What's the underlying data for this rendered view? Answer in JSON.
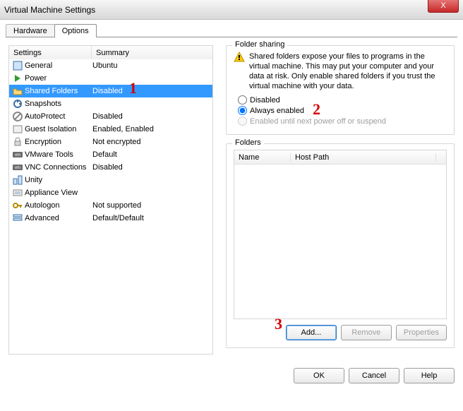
{
  "window": {
    "title": "Virtual Machine Settings",
    "close": "X"
  },
  "tabs": {
    "hardware": "Hardware",
    "options": "Options"
  },
  "left": {
    "col_settings": "Settings",
    "col_summary": "Summary",
    "items": [
      {
        "name": "General",
        "summary": "Ubuntu",
        "icon": "settings"
      },
      {
        "name": "Power",
        "summary": "",
        "icon": "power"
      },
      {
        "name": "Shared Folders",
        "summary": "Disabled",
        "icon": "folder",
        "selected": true
      },
      {
        "name": "Snapshots",
        "summary": "",
        "icon": "snapshot"
      },
      {
        "name": "AutoProtect",
        "summary": "Disabled",
        "icon": "autoprotect"
      },
      {
        "name": "Guest Isolation",
        "summary": "Enabled, Enabled",
        "icon": "isolation"
      },
      {
        "name": "Encryption",
        "summary": "Not encrypted",
        "icon": "lock"
      },
      {
        "name": "VMware Tools",
        "summary": "Default",
        "icon": "vmw"
      },
      {
        "name": "VNC Connections",
        "summary": "Disabled",
        "icon": "vmw"
      },
      {
        "name": "Unity",
        "summary": "",
        "icon": "unity"
      },
      {
        "name": "Appliance View",
        "summary": "",
        "icon": "appliance"
      },
      {
        "name": "Autologon",
        "summary": "Not supported",
        "icon": "key"
      },
      {
        "name": "Advanced",
        "summary": "Default/Default",
        "icon": "advanced"
      }
    ]
  },
  "sharing": {
    "legend": "Folder sharing",
    "warning": "Shared folders expose your files to programs in the virtual machine. This may put your computer and your data at risk. Only enable shared folders if you trust the virtual machine with your data.",
    "opt_disabled": "Disabled",
    "opt_always": "Always enabled",
    "opt_until": "Enabled until next power off or suspend"
  },
  "folders": {
    "legend": "Folders",
    "col_name": "Name",
    "col_host": "Host Path",
    "btn_add": "Add...",
    "btn_remove": "Remove",
    "btn_props": "Properties"
  },
  "footer": {
    "ok": "OK",
    "cancel": "Cancel",
    "help": "Help"
  },
  "annotations": {
    "a1": "1",
    "a2": "2",
    "a3": "3"
  }
}
